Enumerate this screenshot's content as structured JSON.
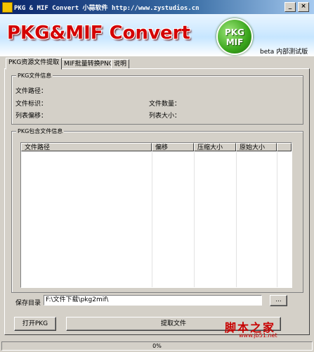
{
  "window": {
    "title": "PKG & MIF Convert 小蒜软件 http://www.zystudios.cn",
    "min_label": "_",
    "close_label": "×"
  },
  "banner": {
    "logo_text": "PKG&MIF Convert",
    "badge_line1": "PKG",
    "badge_line2": "MIF",
    "version": "beta 内部测试版"
  },
  "tabs": [
    {
      "label": "PKG资源文件提取",
      "active": true
    },
    {
      "label": "MIF批量转换PNG",
      "active": false
    },
    {
      "label": "说明",
      "active": false
    }
  ],
  "pkg_info": {
    "legend": "PKG文件信息",
    "path_label": "文件路径：",
    "id_label": "文件标识：",
    "count_label": "文件数量：",
    "offset_label": "列表偏移：",
    "size_label": "列表大小："
  },
  "contents": {
    "legend": "PKG包含文件信息",
    "columns": [
      "文件路径",
      "偏移",
      "压缩大小",
      "原始大小"
    ]
  },
  "save": {
    "label": "保存目录",
    "path_value": "F:\\文件下载\\pkg2mif\\",
    "browse_label": "..."
  },
  "actions": {
    "open_label": "打开PKG",
    "extract_label": "提取文件"
  },
  "status": {
    "progress_text": "0%",
    "progress": 0
  },
  "watermark": {
    "text": "脚本之家",
    "url": "www.jb51.net"
  },
  "colors": {
    "logo_red": "#d40000",
    "badge_green": "#3aa61c",
    "titlebar_blue": "#0a246a"
  }
}
